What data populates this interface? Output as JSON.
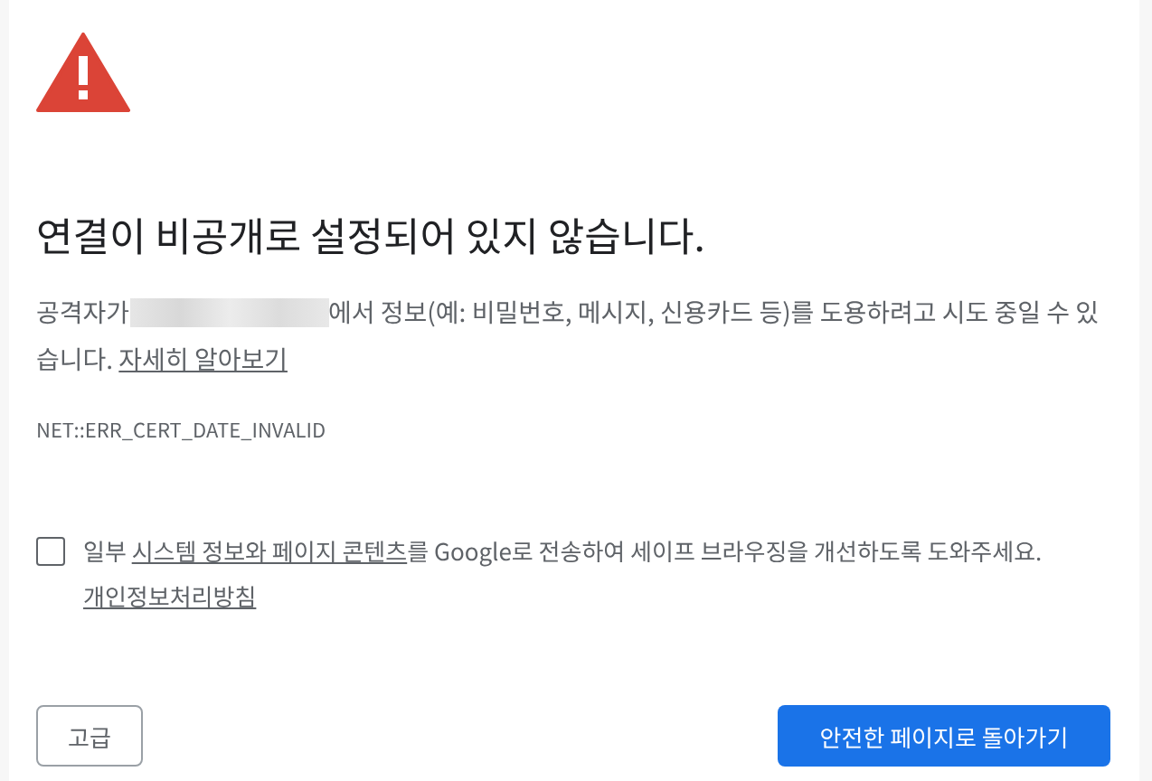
{
  "heading": "연결이 비공개로 설정되어 있지 않습니다.",
  "warning": {
    "before": "공격자가",
    "after": "에서 정보(예: 비밀번호, 메시지, 신용카드 등)를 도용하려고 시도 중일 수 있습니다.",
    "link": "자세히 알아보기"
  },
  "error_code": "NET::ERR_CERT_DATE_INVALID",
  "consent": {
    "checked": false,
    "before": "일부",
    "link": "시스템 정보와 페이지 콘텐츠",
    "after": "를 Google로 전송하여 세이프 브라우징을 개선하도록 도와주세요.",
    "policy_link": "개인정보처리방침"
  },
  "buttons": {
    "advanced": "고급",
    "back": "안전한 페이지로 돌아가기"
  }
}
